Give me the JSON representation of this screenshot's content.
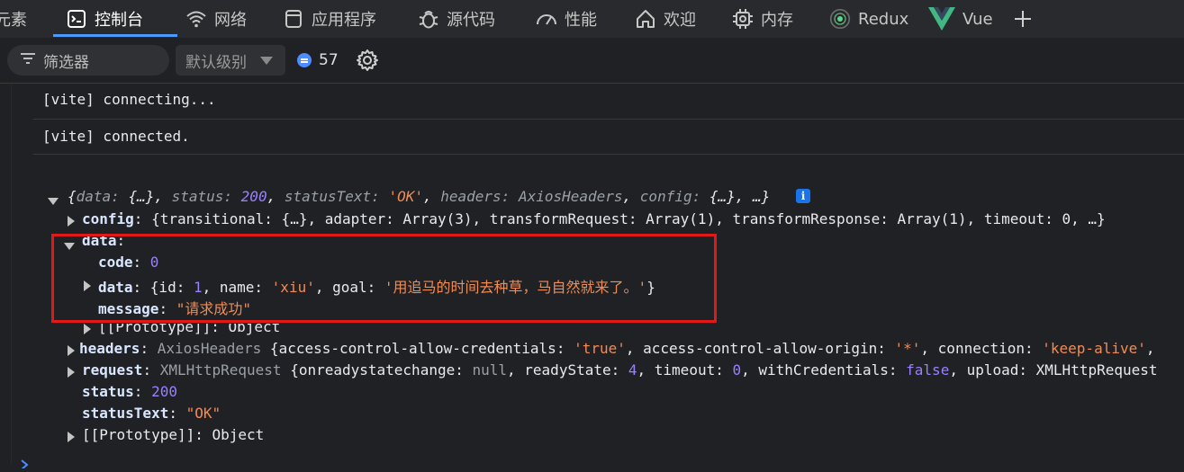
{
  "tabs": [
    {
      "label": "元素",
      "icon": "elements-icon"
    },
    {
      "label": "控制台",
      "icon": "console-icon",
      "active": true
    },
    {
      "label": "网络",
      "icon": "wifi-icon"
    },
    {
      "label": "应用程序",
      "icon": "application-icon"
    },
    {
      "label": "源代码",
      "icon": "bug-icon"
    },
    {
      "label": "性能",
      "icon": "performance-icon"
    },
    {
      "label": "欢迎",
      "icon": "home-icon"
    },
    {
      "label": "内存",
      "icon": "memory-chip-icon"
    },
    {
      "label": "Redux",
      "icon": "redux-icon"
    },
    {
      "label": "Vue",
      "icon": "vue-logo-icon"
    }
  ],
  "toolbar": {
    "filter_placeholder": "筛选器",
    "level_label": "默认级别",
    "message_count": "57"
  },
  "console": {
    "messages": [
      "[vite] connecting...",
      "[vite] connected."
    ],
    "object_summary": {
      "open": "{",
      "k_data": "data",
      "v_data": "{…}",
      "k_status": "status",
      "v_status": "200",
      "k_statusText": "statusText",
      "v_statusText": "'OK'",
      "k_headers": "headers",
      "v_headers": "AxiosHeaders",
      "k_config": "config",
      "v_config": "{…}",
      "tail": ", …}",
      "info": "i"
    },
    "config_line": {
      "key": "config",
      "value": "{transitional: {…}, adapter: Array(3), transformRequest: Array(1), transformResponse: Array(1), timeout: 0, …}"
    },
    "data_block": {
      "key": "data",
      "code_key": "code",
      "code_val": "0",
      "inner_key": "data",
      "inner_open": "{id: ",
      "inner_id": "1",
      "inner_name_key": ", name: ",
      "inner_name": "'xiu'",
      "inner_goal_key": ", goal: ",
      "inner_goal": "'用追马的时间去种草，马自然就来了。'",
      "inner_close": "}",
      "message_key": "message",
      "message_val": "\"请求成功\"",
      "proto": "[[Prototype]]: Object"
    },
    "headers_line": {
      "key": "headers",
      "type": "AxiosHeaders",
      "open": " {access-control-allow-credentials: ",
      "v1": "'true'",
      "mid": ", access-control-allow-origin: ",
      "v2": "'*'",
      "mid2": ", connection: ",
      "v3": "'keep-alive'",
      "end": ","
    },
    "request_line": {
      "key": "request",
      "type": "XMLHttpRequest",
      "open": " {onreadystatechange: ",
      "v1": "null",
      "mid": ", readyState: ",
      "v2": "4",
      "mid2": ", timeout: ",
      "v3": "0",
      "mid3": ", withCredentials: ",
      "v4": "false",
      "end": ", upload: XMLHttpRequest"
    },
    "status_key": "status",
    "status_val": "200",
    "statusText_key": "statusText",
    "statusText_val": "\"OK\"",
    "proto_line": "[[Prototype]]: Object"
  }
}
